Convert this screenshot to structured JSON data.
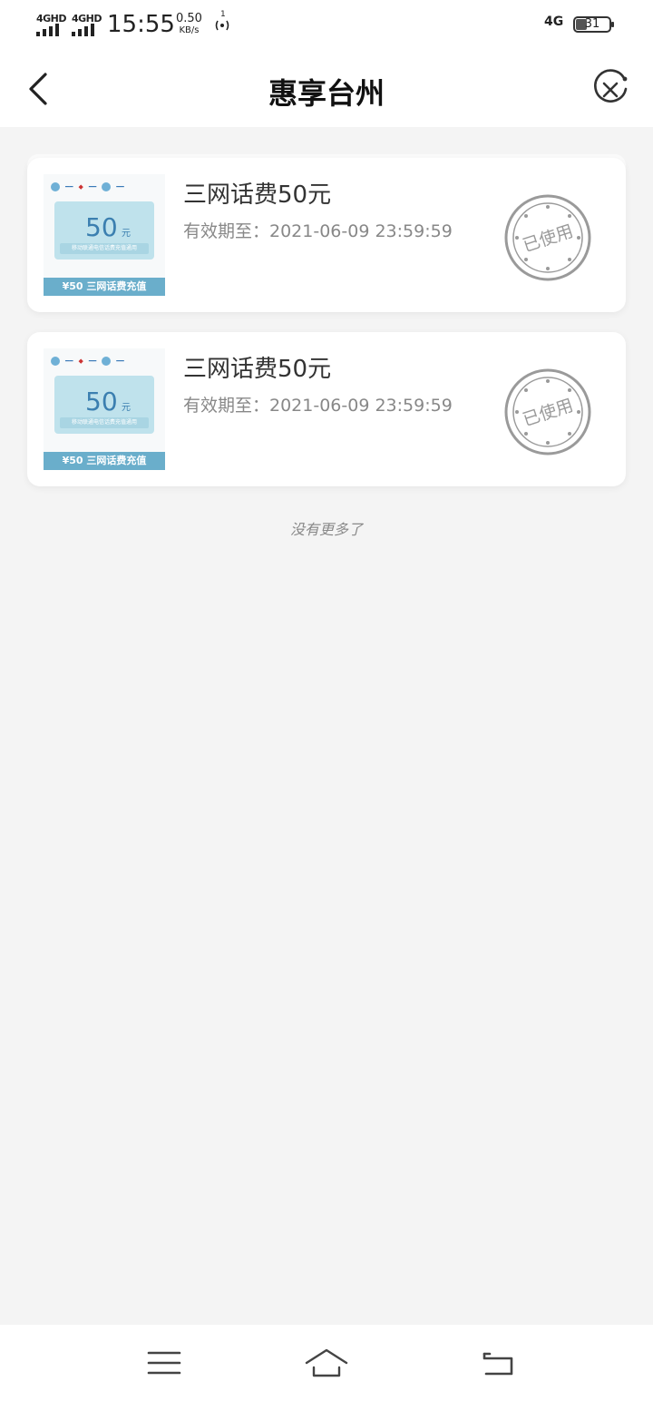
{
  "status_bar": {
    "signal1_label": "4GHD",
    "signal2_label": "4GHD",
    "time": "15:55",
    "speed_value": "0.50",
    "speed_unit": "KB/s",
    "hotspot_count": "1",
    "network_label": "4G",
    "battery": "31"
  },
  "header": {
    "title": "惠享台州"
  },
  "vouchers": [
    {
      "title": "三网话费50元",
      "expiry": "有效期至：2021-06-09 23:59:59",
      "thumb_amount": "50",
      "thumb_yuan": "元",
      "thumb_subtitle": "移动联通电信话费充值通用",
      "thumb_band": "¥50 三网话费充值",
      "stamp": "已使用"
    },
    {
      "title": "三网话费50元",
      "expiry": "有效期至：2021-06-09 23:59:59",
      "thumb_amount": "50",
      "thumb_yuan": "元",
      "thumb_subtitle": "移动联通电信话费充值通用",
      "thumb_band": "¥50 三网话费充值",
      "stamp": "已使用"
    }
  ],
  "list_footer": "没有更多了",
  "icons": {
    "back": "chevron-left-icon",
    "close": "close-circle-icon",
    "menu": "menu-icon",
    "home": "home-icon",
    "return": "return-icon"
  },
  "colors": {
    "background": "#f4f4f4",
    "card": "#ffffff",
    "stamp_gray": "#9a9a9a",
    "thumb_blue": "#6aaecb"
  }
}
